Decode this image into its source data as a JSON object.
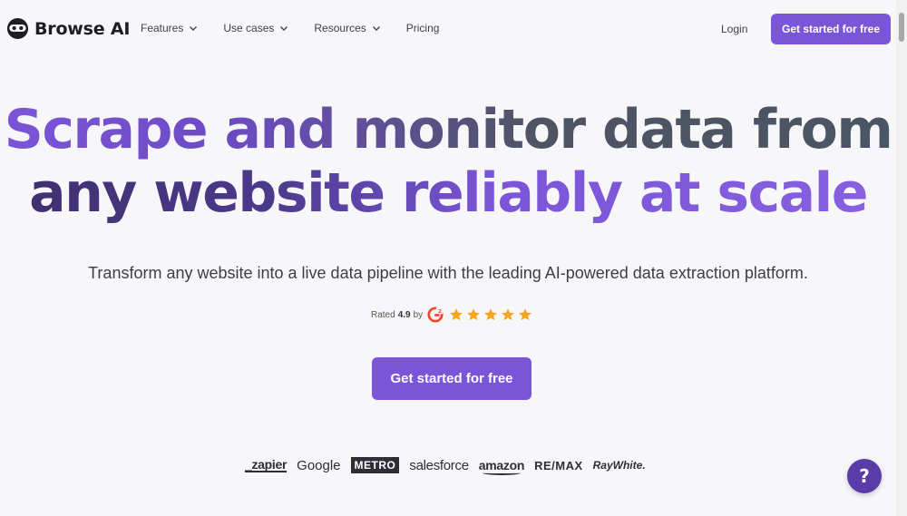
{
  "brand": {
    "name": "Browse AI",
    "logo_icon": "robot-face-icon"
  },
  "nav": {
    "items": [
      {
        "label": "Features",
        "has_dropdown": true
      },
      {
        "label": "Use cases",
        "has_dropdown": true
      },
      {
        "label": "Resources",
        "has_dropdown": true
      },
      {
        "label": "Pricing",
        "has_dropdown": false
      }
    ],
    "login": "Login",
    "cta": "Get started for free"
  },
  "hero": {
    "headline_line1": "Scrape and monitor data from",
    "headline_line2": "any website reliably at scale",
    "subtitle": "Transform any website into a live data pipeline with the leading AI-powered data extraction platform.",
    "rating_prefix": "Rated",
    "rating_value": "4.9",
    "rating_by": "by",
    "rating_source_icon": "g2-icon",
    "stars": 5,
    "cta": "Get started for free"
  },
  "logos": [
    "_zapier",
    "Google",
    "METRO",
    "salesforce",
    "amazon",
    "RE/MAX",
    "RayWhite."
  ],
  "help": {
    "label": "?"
  },
  "colors": {
    "accent": "#7b55d8",
    "help": "#5a3ca8",
    "star": "#f5a623",
    "g2": "#ef4a26",
    "background": "#f7f7fa"
  }
}
